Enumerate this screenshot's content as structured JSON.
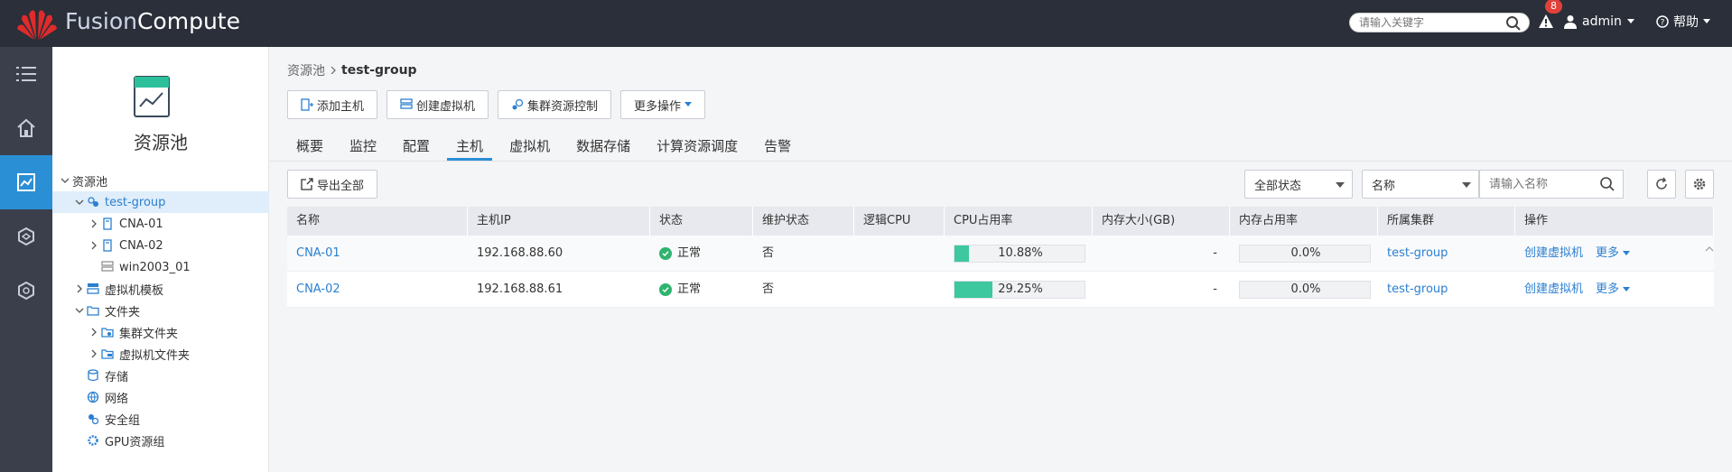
{
  "header": {
    "brand_part1": "Fusion",
    "brand_part2": "Compute",
    "search_placeholder": "请输入关键字",
    "alert_count": "8",
    "user_name": "admin",
    "help_label": "帮助",
    "colors": {
      "bg": "#2b2f3a",
      "badge": "#e0413a"
    }
  },
  "leftnav": {
    "items": [
      {
        "icon": "list-icon"
      },
      {
        "icon": "home-icon"
      },
      {
        "icon": "resource-pool-icon",
        "active": true
      },
      {
        "icon": "network-icon"
      },
      {
        "icon": "system-icon"
      }
    ],
    "active_color": "#2b8fd6"
  },
  "tree": {
    "title": "资源池",
    "items": [
      {
        "label": "资源池",
        "level": 0,
        "expanded": true,
        "icon": ""
      },
      {
        "label": "test-group",
        "level": 1,
        "expanded": true,
        "icon": "cluster-icon",
        "selected": true
      },
      {
        "label": "CNA-01",
        "level": 2,
        "expanded": false,
        "icon": "host-icon"
      },
      {
        "label": "CNA-02",
        "level": 2,
        "expanded": false,
        "icon": "host-icon"
      },
      {
        "label": "win2003_01",
        "level": 2,
        "icon": "vm-icon"
      },
      {
        "label": "虚拟机模板",
        "level": 1,
        "expanded": false,
        "icon": "template-icon"
      },
      {
        "label": "文件夹",
        "level": 1,
        "expanded": true,
        "icon": "folder-icon"
      },
      {
        "label": "集群文件夹",
        "level": 2,
        "expanded": false,
        "icon": "cluster-folder-icon"
      },
      {
        "label": "虚拟机文件夹",
        "level": 2,
        "expanded": false,
        "icon": "vm-folder-icon"
      },
      {
        "label": "存储",
        "level": 1,
        "icon": "storage-icon"
      },
      {
        "label": "网络",
        "level": 1,
        "icon": "network-icon"
      },
      {
        "label": "安全组",
        "level": 1,
        "icon": "security-group-icon"
      },
      {
        "label": "GPU资源组",
        "level": 1,
        "icon": "gpu-icon"
      }
    ]
  },
  "breadcrumb": {
    "root": "资源池",
    "current": "test-group"
  },
  "toolbar": {
    "add_host": "添加主机",
    "create_vm": "创建虚拟机",
    "cluster_resource_control": "集群资源控制",
    "more_ops": "更多操作"
  },
  "tabs": [
    {
      "label": "概要"
    },
    {
      "label": "监控"
    },
    {
      "label": "配置"
    },
    {
      "label": "主机",
      "active": true
    },
    {
      "label": "虚拟机"
    },
    {
      "label": "数据存储"
    },
    {
      "label": "计算资源调度"
    },
    {
      "label": "告警"
    }
  ],
  "filters": {
    "export_all": "导出全部",
    "status_select": "全部状态",
    "field_select": "名称",
    "search_placeholder": "请输入名称"
  },
  "table": {
    "columns": [
      "名称",
      "主机IP",
      "状态",
      "维护状态",
      "逻辑CPU",
      "CPU占用率",
      "内存大小(GB)",
      "内存占用率",
      "所属集群",
      "操作"
    ],
    "rows": [
      {
        "name": "CNA-01",
        "ip": "192.168.88.60",
        "status": "正常",
        "maintenance": "否",
        "logical_cpu": "",
        "cpu_usage_text": "10.88%",
        "cpu_usage": 10.88,
        "memory": "-",
        "mem_usage_text": "0.0%",
        "mem_usage": 0.0,
        "cluster": "test-group",
        "action_create": "创建虚拟机",
        "action_more": "更多"
      },
      {
        "name": "CNA-02",
        "ip": "192.168.88.61",
        "status": "正常",
        "maintenance": "否",
        "logical_cpu": "",
        "cpu_usage_text": "29.25%",
        "cpu_usage": 29.25,
        "memory": "-",
        "mem_usage_text": "0.0%",
        "mem_usage": 0.0,
        "cluster": "test-group",
        "action_create": "创建虚拟机",
        "action_more": "更多"
      }
    ],
    "colors": {
      "status_ok": "#2fb36e",
      "progress": "#3dc8a0",
      "link": "#2b7fd1"
    }
  }
}
